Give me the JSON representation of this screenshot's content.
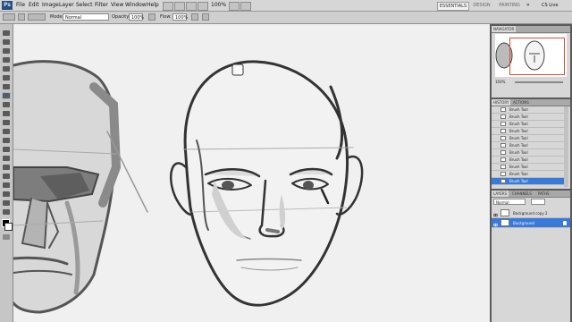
{
  "menubar": {
    "logo": "Ps",
    "items": [
      "File",
      "Edit",
      "Image",
      "Layer",
      "Select",
      "Filter",
      "View",
      "Window",
      "Help"
    ],
    "zoom": "100%",
    "workspaces": [
      "ESSENTIALS",
      "DESIGN",
      "PAINTING"
    ],
    "more": "»",
    "cslive": "CS Live"
  },
  "options": {
    "mode_label": "Mode:",
    "mode_value": "Normal",
    "opacity_label": "Opacity:",
    "opacity_value": "100%",
    "flow_label": "Flow:",
    "flow_value": "100%"
  },
  "navigator": {
    "tab": "NAVIGATOR",
    "zoom": "100%"
  },
  "history": {
    "tabs": [
      "HISTORY",
      "ACTIONS"
    ],
    "items": [
      "Brush Tool",
      "Brush Tool",
      "Brush Tool",
      "Brush Tool",
      "Brush Tool",
      "Brush Tool",
      "Brush Tool",
      "Brush Tool",
      "Brush Tool",
      "Brush Tool",
      "Brush Tool"
    ]
  },
  "layers": {
    "tabs": [
      "LAYERS",
      "CHANNELS",
      "PATHS"
    ],
    "blend": "Normal",
    "items": [
      {
        "name": "Background copy 2",
        "selected": false
      },
      {
        "name": "Background",
        "selected": true
      }
    ]
  },
  "colors": {
    "accent": "#3a79d8",
    "nav_frame": "#e04a2b"
  }
}
